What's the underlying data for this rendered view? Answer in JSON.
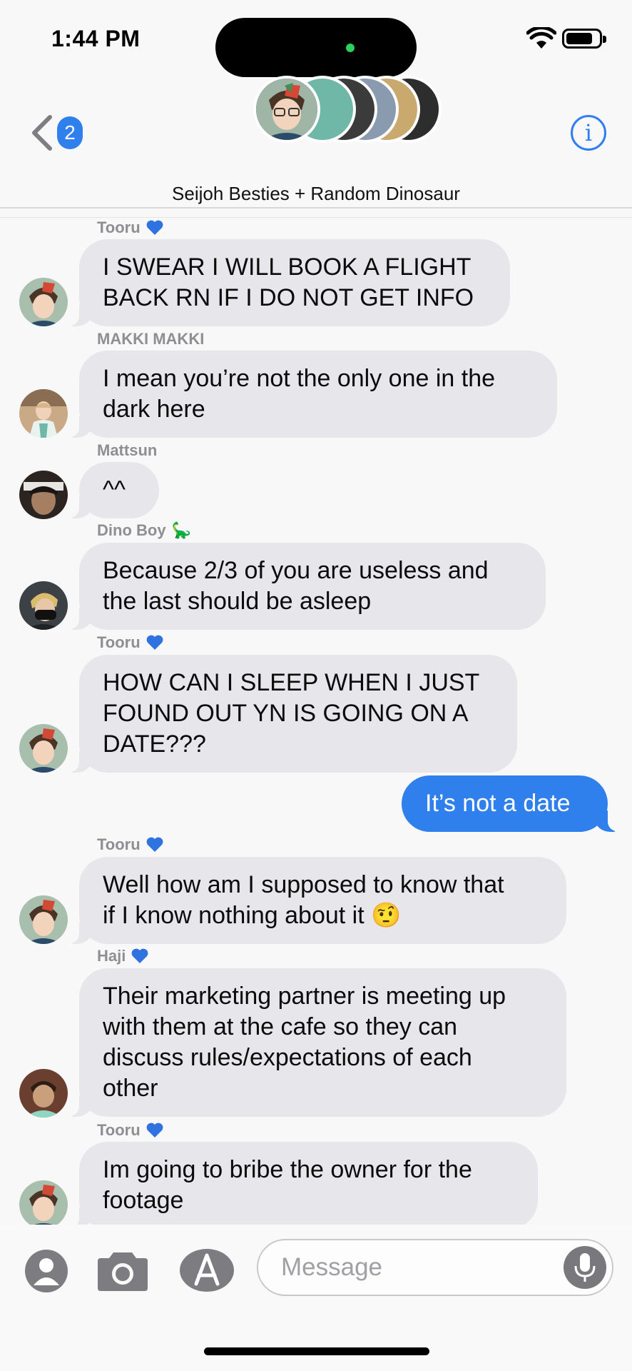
{
  "status_bar": {
    "time": "1:44 PM"
  },
  "header": {
    "back_badge": "2",
    "title": "Seijoh Besties + Random Dinosaur",
    "info_glyph": "i"
  },
  "colors": {
    "accent": "#2f80ed",
    "incoming_bubble": "#e6e6eb",
    "heart": "#2f73e0"
  },
  "messages": [
    {
      "sender": "Tooru",
      "heart": true,
      "text": "I SWEAR I WILL BOOK A FLIGHT\nBACK RN IF I DO NOT GET INFO",
      "avatar": "tooru-avatar"
    },
    {
      "sender": "MAKKI MAKKI",
      "heart": false,
      "text": "I mean you’re not the only one in the\ndark here",
      "avatar": "makki-avatar"
    },
    {
      "sender": "Mattsun",
      "heart": false,
      "text": "^^",
      "avatar": "mattsun-avatar"
    },
    {
      "sender": "Dino Boy",
      "emoji": "🦕",
      "text": "Because 2/3 of you are useless and\nthe last should be asleep",
      "avatar": "dino-avatar"
    },
    {
      "sender": "Tooru",
      "heart": true,
      "text": "HOW CAN I SLEEP WHEN I JUST\nFOUND OUT YN IS GOING ON A\nDATE???",
      "avatar": "tooru-avatar"
    },
    {
      "outgoing": true,
      "text": "It’s not a date"
    },
    {
      "sender": "Tooru",
      "heart": true,
      "text": "Well how am I supposed to know that\nif I know nothing about it 🤨",
      "avatar": "tooru-avatar"
    },
    {
      "sender": "Haji",
      "heart": true,
      "text": "Their marketing partner is meeting up\nwith them at the cafe so they can\ndiscuss rules/expectations of each\nother",
      "avatar": "haji-avatar"
    },
    {
      "sender": "Tooru",
      "heart": true,
      "text": "Im going to bribe the owner for the\nfootage",
      "avatar": "tooru-avatar"
    }
  ],
  "composer": {
    "placeholder": "Message"
  }
}
